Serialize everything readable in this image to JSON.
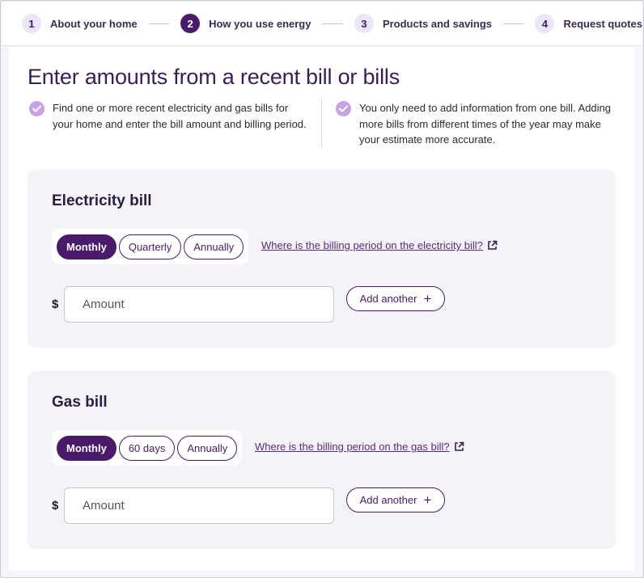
{
  "stepper": {
    "steps": [
      {
        "number": "1",
        "label": "About your home",
        "state": "inactive"
      },
      {
        "number": "2",
        "label": "How you use energy",
        "state": "active"
      },
      {
        "number": "3",
        "label": "Products and savings",
        "state": "inactive"
      },
      {
        "number": "4",
        "label": "Request quotes",
        "state": "inactive"
      }
    ]
  },
  "page": {
    "title": "Enter amounts from a recent bill or bills",
    "info_left": "Find one or more recent electricity and gas bills for your home and enter the bill amount and billing period.",
    "info_right": "You only need to add information from one bill. Adding more bills from different times of the year may make your estimate more accurate."
  },
  "electricity": {
    "title": "Electricity bill",
    "periods": [
      "Monthly",
      "Quarterly",
      "Annually"
    ],
    "selected_period": "Monthly",
    "help_link": "Where is the billing period on the electricity bill?",
    "currency": "$",
    "amount_placeholder": "Amount",
    "amount_value": "",
    "add_label": "Add another"
  },
  "gas": {
    "title": "Gas bill",
    "periods": [
      "Monthly",
      "60 days",
      "Annually"
    ],
    "selected_period": "Monthly",
    "help_link": "Where is the billing period on the gas bill?",
    "currency": "$",
    "amount_placeholder": "Amount",
    "amount_value": "",
    "add_label": "Add another"
  },
  "colors": {
    "brand": "#4a1a6b",
    "accent_light": "#c7a3e4",
    "card_bg": "#f4f3f8"
  },
  "icons": {
    "check": "check-circle-icon",
    "external": "external-link-icon",
    "plus": "plus-icon"
  }
}
